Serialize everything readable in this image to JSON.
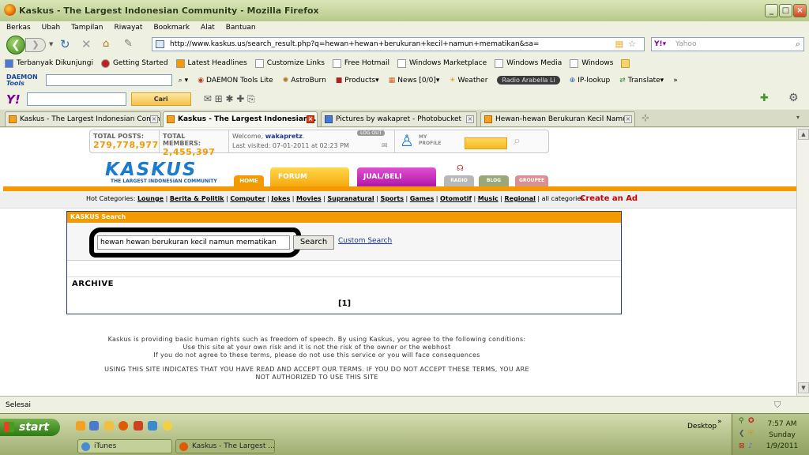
{
  "window": {
    "title": "Kaskus - The Largest Indonesian Community - Mozilla Firefox"
  },
  "menu": [
    "Berkas",
    "Ubah",
    "Tampilan",
    "Riwayat",
    "Bookmark",
    "Alat",
    "Bantuan"
  ],
  "nav": {
    "url": "http://www.kaskus.us/search_result.php?q=hewan+hewan+berukuran+kecil+namun+mematikan&sa=",
    "search_placeholder": "Yahoo"
  },
  "bookmarks": [
    "Terbanyak Dikunjungi",
    "Getting Started",
    "Latest Headlines",
    "Customize Links",
    "Free Hotmail",
    "Windows Marketplace",
    "Windows Media",
    "Windows"
  ],
  "daemon_toolbar": {
    "logo_line1": "DAEMON",
    "logo_line2": "Tools",
    "items": [
      "DAEMON Tools Lite",
      "AstroBurn",
      "Products",
      "News [0/0]",
      "Weather",
      "Radio Arabella Li",
      "IP-lookup",
      "Translate"
    ]
  },
  "yahoo_toolbar": {
    "logo": "Y!",
    "button": "Cari"
  },
  "tabs": [
    {
      "label": "Kaskus - The Largest Indonesian Comm...",
      "active": false
    },
    {
      "label": "Kaskus - The Largest Indonesian ...",
      "active": true
    },
    {
      "label": "Pictures by wakapret - Photobucket",
      "active": false
    },
    {
      "label": "Hewan-hewan Berukuran Kecil Namun ...",
      "active": false
    }
  ],
  "page": {
    "stats": {
      "posts_label": "TOTAL POSTS:",
      "posts_value": "279,778,977",
      "members_label": "TOTAL MEMBERS:",
      "members_value": "2,455,397",
      "welcome": "Welcome, ",
      "username": "wakapretz",
      "last_visited": "Last visited: 07-01-2011 at 02:23 PM",
      "logout": "LOG OUT",
      "my_profile": "MY PROFILE"
    },
    "logo": {
      "text": "KASKUS",
      "tagline": "THE LARGEST INDONESIAN COMMUNITY"
    },
    "nav_tabs": [
      "HOME",
      "FORUM",
      "JUAL/BELI",
      "RADIO",
      "BLOG",
      "GROUPEE"
    ],
    "hot_categories_label": "Hot Categories:",
    "hot_categories": [
      "Lounge",
      "Berita & Politik",
      "Computer",
      "Jokes",
      "Movies",
      "Supranatural",
      "Sports",
      "Games",
      "Otomotif",
      "Music",
      "Regional"
    ],
    "all_categories": "all categories",
    "create_ad": "Create an Ad",
    "search_panel": {
      "header": "KASKUS Search",
      "query": "hewan hewan berukuran kecil namun mematikan",
      "button": "Search",
      "custom_search": "Custom Search",
      "archive": "ARCHIVE",
      "page": "[1]"
    },
    "disclaimer": {
      "line1": "Kaskus is providing basic human rights such as freedom of speech. By using Kaskus, you agree to the following conditions:",
      "line2": "Use this site at your own risk and it is not the risk of the owner or the webhost",
      "line3": "If you do not agree to these terms, please do not use this service or you will face consequences",
      "line4": "USING THIS SITE INDICATES THAT YOU HAVE READ AND ACCEPT OUR TERMS. IF YOU DO NOT ACCEPT THESE TERMS, YOU ARE",
      "line5": "NOT AUTHORIZED TO USE THIS SITE"
    }
  },
  "status": "Selesai",
  "taskbar": {
    "start": "start",
    "desktop": "Desktop",
    "buttons": [
      "iTunes",
      "Kaskus - The Largest ..."
    ],
    "clock": {
      "time": "7:57 AM",
      "day": "Sunday",
      "date": "1/9/2011"
    }
  }
}
